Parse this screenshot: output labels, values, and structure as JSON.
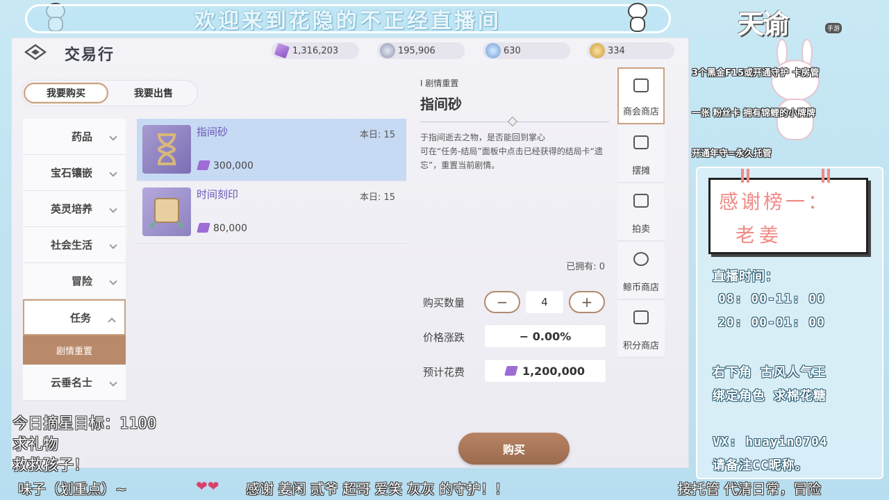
{
  "stream": {
    "banner_title": "欢迎来到花隐的不正经直播间",
    "logo_text": "天谕",
    "logo_badge": "手游"
  },
  "game": {
    "title": "交易行",
    "currencies": [
      {
        "icon": "purple-gem-icon",
        "value": "1,316,203"
      },
      {
        "icon": "silver-coin-icon",
        "value": "195,906"
      },
      {
        "icon": "blue-crystal-icon",
        "value": "630"
      },
      {
        "icon": "gold-coin-icon",
        "value": "334"
      }
    ],
    "mode_tabs": [
      "我要购买",
      "我要出售"
    ],
    "categories": [
      "药品",
      "宝石镶嵌",
      "英灵培养",
      "社会生活",
      "冒险",
      "任务",
      "云垂名士"
    ],
    "open_category_sub": "剧情重置",
    "items": [
      {
        "name": "指间砂",
        "today": "本日: 15",
        "price": "300,000"
      },
      {
        "name": "时间刻印",
        "today": "本日: 15",
        "price": "80,000"
      }
    ],
    "detail": {
      "category": "I 剧情重置",
      "name": "指间砂",
      "description": "于指间逝去之物，是否能回到掌心\n可在“任务-结局”面板中点击已经获得的结局卡“遗忘”，重置当前剧情。",
      "owned": "已拥有: 0",
      "qty_label": "购买数量",
      "qty": "4",
      "minus": "−",
      "plus": "+",
      "change_label": "价格涨跌",
      "change_value": "− 0.00%",
      "cost_label": "预计花费",
      "cost_value": "1,200,000",
      "buy_label": "购买"
    },
    "side_tabs": [
      "商会商店",
      "摆摊",
      "拍卖",
      "鲸币商店",
      "积分商店"
    ]
  },
  "overlay": {
    "ann1": "3个黑金F15或开通守护 卡房管",
    "ann2": "一张 粉丝卡 拥有锦鲤的小牌牌",
    "ann3": "开通年守=永久托管",
    "thanks_title": "感谢榜一：",
    "thanks_name": "老姜",
    "live_time_label": "直播时间：",
    "time1": "08: 00-11: 00",
    "time2": "20: 00-01: 00",
    "promo1": "右下角 古风人气王",
    "promo2": "绑定角色 求棉花糖",
    "vx": "VX: huayin0704",
    "vx_note": "请备注CC昵称。",
    "left1": "今日摘星目标：1100",
    "left2": "求礼物",
    "left3": "救救孩子！",
    "ticker1": "味子（划重点）~",
    "ticker_hearts": "❤❤",
    "ticker2": "感谢 姜闲 贰爷 超哥 爱笑 灰灰 的守护！！",
    "ticker3": "接托管 代清日常，冒险"
  },
  "colors": {
    "accent": "#c9a27f",
    "selected": "#c7daf4",
    "button": "#a8765a"
  }
}
